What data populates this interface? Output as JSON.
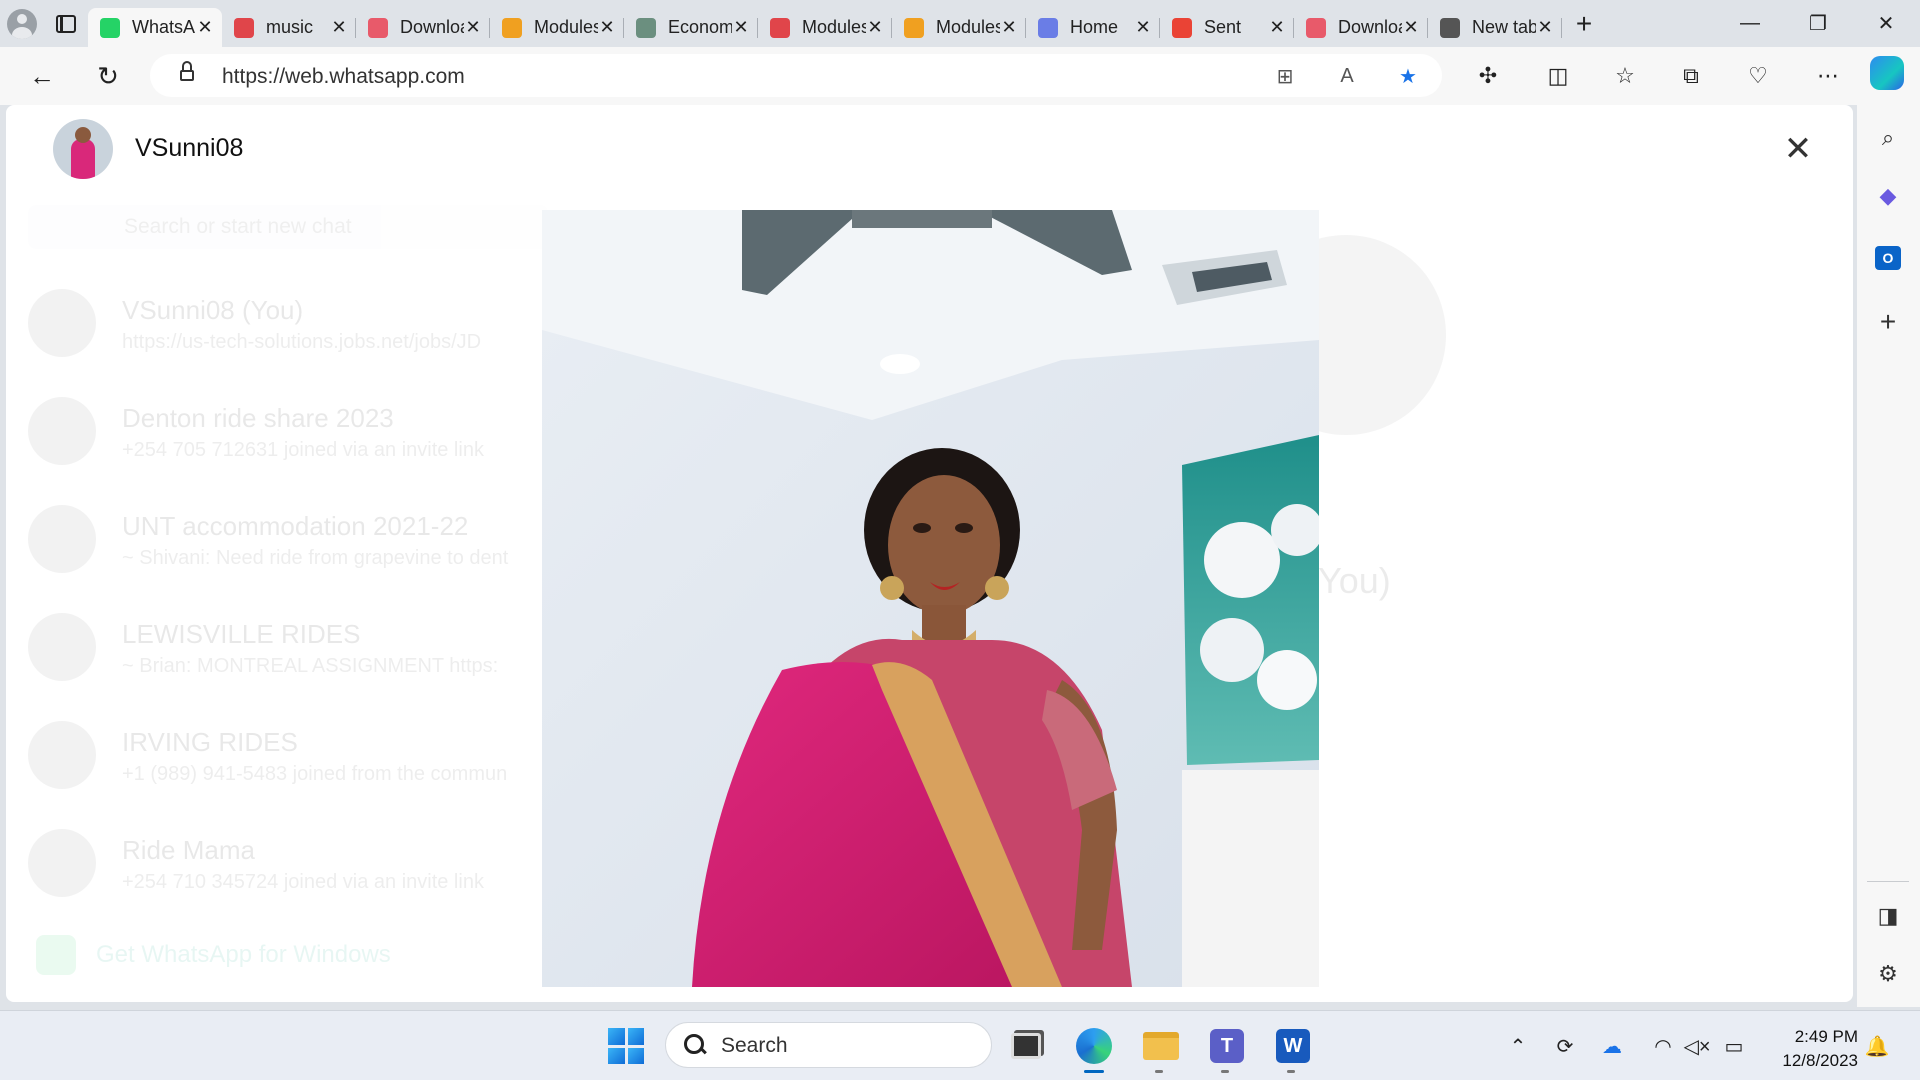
{
  "browser": {
    "tabs": [
      {
        "title": "WhatsApp",
        "icon": "whatsapp-icon",
        "color": "#25d366",
        "active": true
      },
      {
        "title": "music",
        "icon": "pdf-icon",
        "color": "#e0454a",
        "active": false
      },
      {
        "title": "Download",
        "icon": "heart-icon",
        "color": "#e85a6a",
        "active": false
      },
      {
        "title": "Modules",
        "icon": "infinity-icon",
        "color": "#f0a020",
        "active": false
      },
      {
        "title": "Economics",
        "icon": "openai-icon",
        "color": "#6b8f7f",
        "active": false
      },
      {
        "title": "Modules",
        "icon": "infinity-icon",
        "color": "#e0454a",
        "active": false
      },
      {
        "title": "Modules",
        "icon": "infinity-icon",
        "color": "#f0a020",
        "active": false
      },
      {
        "title": "Home",
        "icon": "copilot-icon",
        "color": "#6a7de6",
        "active": false
      },
      {
        "title": "Sent",
        "icon": "gmail-icon",
        "color": "#ea4335",
        "active": false
      },
      {
        "title": "Download",
        "icon": "heart-icon",
        "color": "#e85a6a",
        "active": false
      },
      {
        "title": "New tab",
        "icon": "newtab-icon",
        "color": "#555555",
        "active": false
      }
    ],
    "url": "https://web.whatsapp.com"
  },
  "viewer": {
    "contact_name": "VSunni08",
    "close_label": "✕"
  },
  "background_app": {
    "search_placeholder": "Search or start new chat",
    "chats": [
      {
        "name": "VSunni08 (You)",
        "preview": "https://us-tech-solutions.jobs.net/jobs/JD"
      },
      {
        "name": "Denton ride share 2023",
        "preview": "+254 705 712631 joined via an invite link"
      },
      {
        "name": "UNT accommodation 2021-22",
        "preview": "~ Shivani: Need ride from grapevine to dent"
      },
      {
        "name": "LEWISVILLE RIDES",
        "preview": "~ Brian: MONTREAL ASSIGNMENT https:"
      },
      {
        "name": "IRVING RIDES",
        "preview": "+1 (989) 941-5483 joined from the commun"
      },
      {
        "name": "Ride Mama",
        "preview": "+254 710 345724 joined via an invite link"
      }
    ],
    "get_app": "Get WhatsApp for Windows",
    "profile_you": "(You)"
  },
  "taskbar": {
    "search_label": "Search",
    "time": "2:49 PM",
    "date": "12/8/2023"
  }
}
